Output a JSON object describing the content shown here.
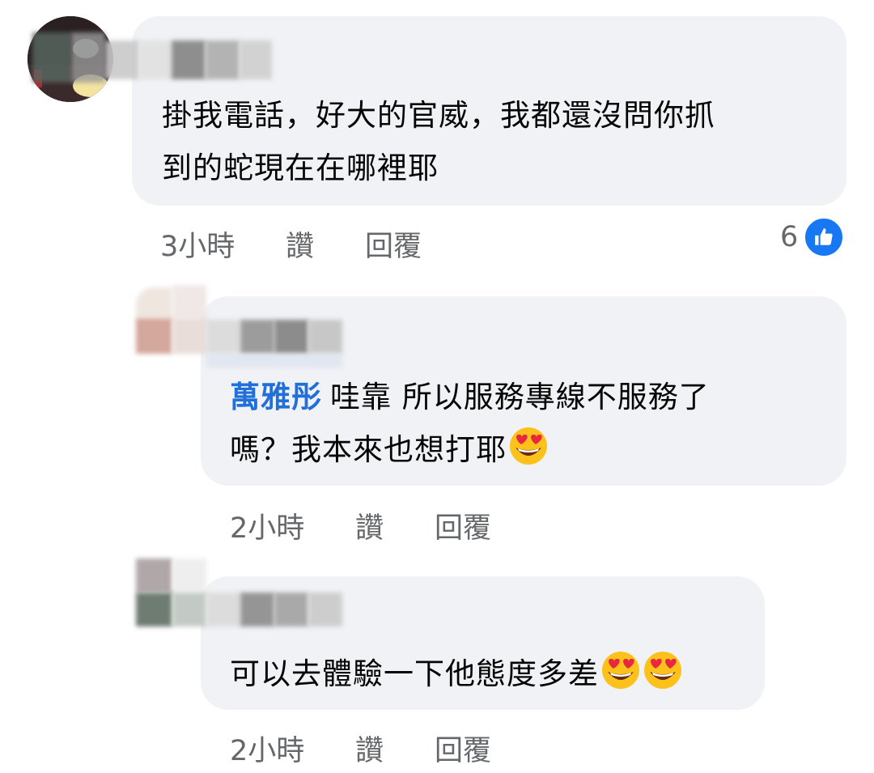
{
  "comments": [
    {
      "text_line1": "掛我電話，好大的官威，我都還沒問你抓",
      "text_line2": "到的蛇現在在哪裡耶",
      "time": "3小時",
      "like_label": "讚",
      "reply_label": "回覆",
      "reaction_count": "6"
    },
    {
      "mention": "萬雅彤",
      "text_line1": "哇靠 所以服務專線不服務了",
      "text_line2": "嗎？我本來也想打耶",
      "emoji": "heart-eyes-emoji",
      "time": "2小時",
      "like_label": "讚",
      "reply_label": "回覆"
    },
    {
      "text_line1": "可以去體驗一下他態度多差",
      "emoji": "heart-eyes-emoji",
      "time": "2小時",
      "like_label": "讚",
      "reply_label": "回覆"
    }
  ],
  "colors": {
    "bubble_bg": "#f0f2f5",
    "text": "#050505",
    "meta_text": "#65676b",
    "mention": "#216fdb",
    "like_badge": "#1877f2"
  }
}
